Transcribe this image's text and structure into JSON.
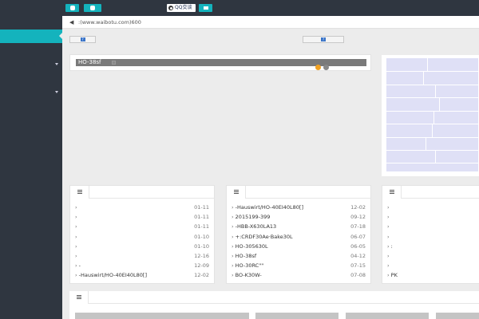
{
  "topbar": {
    "qq_label": "QQ交谈"
  },
  "notice": {
    "text": ":(www.waibotu.com)600"
  },
  "colors": {
    "accent": "#14b3bd",
    "sidebar": "#2f3640",
    "dot_orange": "#f0a020",
    "dot_gray": "#888888"
  },
  "main_panel": {
    "bar_text": "HO-38sf"
  },
  "news_left": {
    "rows": [
      {
        "title": "",
        "date": "01-11"
      },
      {
        "title": "",
        "date": "01-11"
      },
      {
        "title": "",
        "date": "01-11"
      },
      {
        "title": "",
        "date": "01-10"
      },
      {
        "title": "",
        "date": "01-10"
      },
      {
        "title": "",
        "date": "12-16"
      },
      {
        "title": "-",
        "date": "12-09"
      },
      {
        "title": "-Hauswirt/HO-40EI40L80[]",
        "date": "12-02"
      }
    ]
  },
  "news_mid": {
    "rows": [
      {
        "title": "-Hauswirt/HO-40EI40L80[]",
        "date": "12-02"
      },
      {
        "title": "2015199-399",
        "date": "09-12"
      },
      {
        "title": "-HBB-X630LA13",
        "date": "07-18"
      },
      {
        "title": "+:CRDF30Ae·Bake30L",
        "date": "06-07"
      },
      {
        "title": "HO-305630L",
        "date": "06-05"
      },
      {
        "title": "HO-38sf",
        "date": "04-12"
      },
      {
        "title": "HO-30RC\"\"",
        "date": "07-15"
      },
      {
        "title": "BO-K30W-",
        "date": "07-08"
      }
    ]
  },
  "news_right": {
    "rows": [
      {
        "title": ""
      },
      {
        "title": ""
      },
      {
        "title": ""
      },
      {
        "title": ""
      },
      {
        "title": ":"
      },
      {
        "title": ""
      },
      {
        "title": ""
      },
      {
        "title": "PK"
      }
    ]
  }
}
